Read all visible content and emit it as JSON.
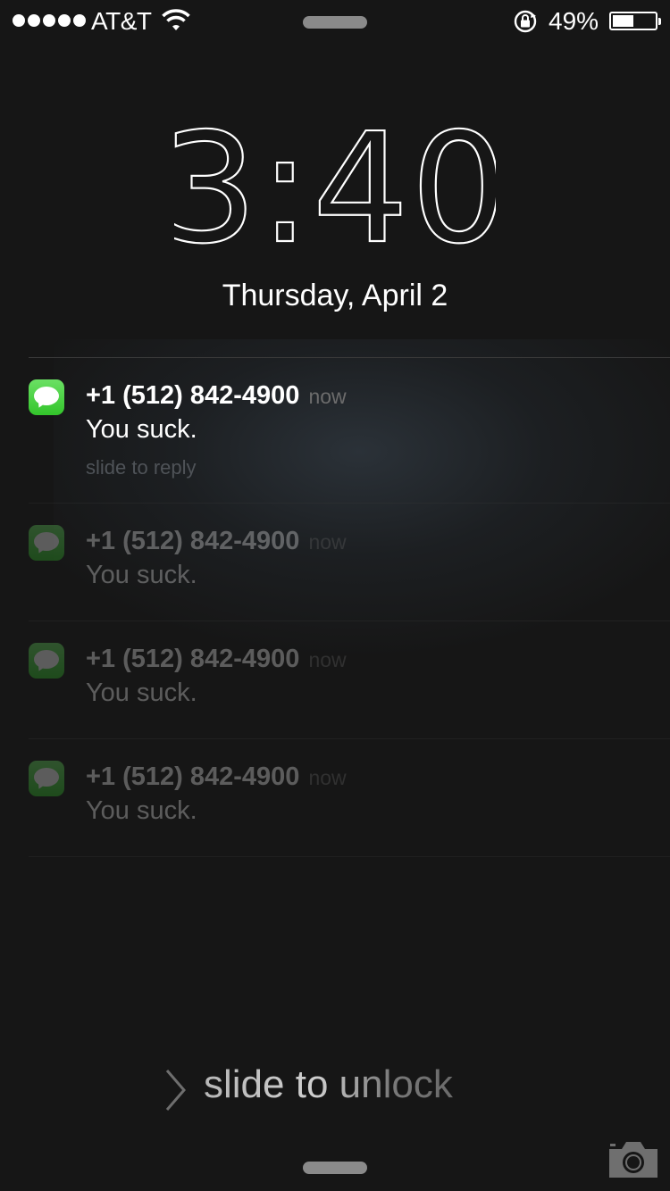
{
  "status_bar": {
    "signal_bars": 5,
    "carrier": "AT&T",
    "wifi_icon": "wifi-icon",
    "rotation_lock_icon": "rotation-lock-icon",
    "battery_percent_text": "49%",
    "battery_level": 0.49
  },
  "lock_screen": {
    "time": "3:40",
    "date": "Thursday, April 2"
  },
  "notifications": [
    {
      "app_icon": "messages-icon",
      "sender": "+1 (512) 842-4900",
      "time": "now",
      "message": "You suck.",
      "action_hint": "slide to reply"
    },
    {
      "app_icon": "messages-icon",
      "sender": "+1 (512) 842-4900",
      "time": "now",
      "message": "You suck."
    },
    {
      "app_icon": "messages-icon",
      "sender": "+1 (512) 842-4900",
      "time": "now",
      "message": "You suck."
    },
    {
      "app_icon": "messages-icon",
      "sender": "+1 (512) 842-4900",
      "time": "now",
      "message": "You suck."
    }
  ],
  "unlock": {
    "label": "slide to unlock",
    "chevron_icon": "chevron-right-icon"
  },
  "camera": {
    "icon": "camera-icon"
  },
  "colors": {
    "background": "#161616",
    "messages_green": "#4cd964"
  }
}
